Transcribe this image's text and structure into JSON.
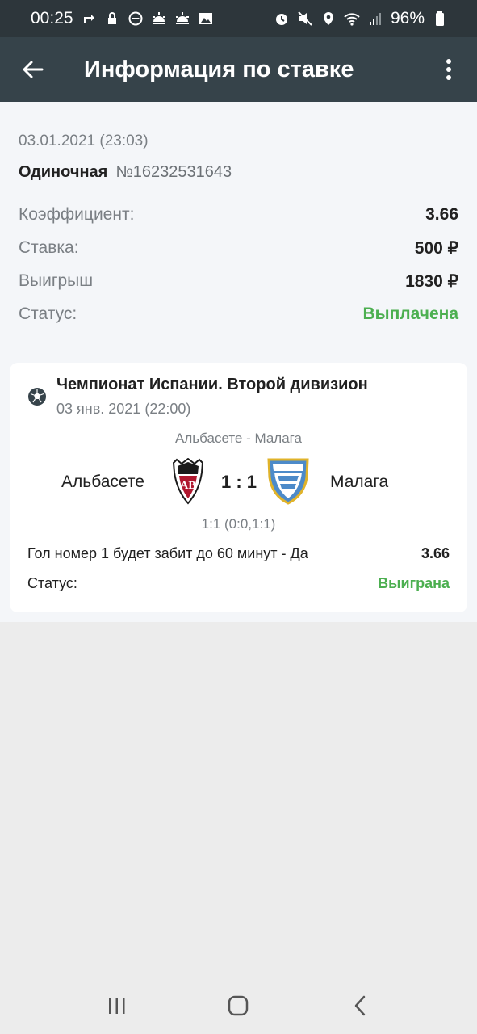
{
  "status_bar": {
    "time": "00:25",
    "battery": "96%"
  },
  "app_bar": {
    "title": "Информация по ставке"
  },
  "bet": {
    "date": "03.01.2021 (23:03)",
    "type": "Одиночная",
    "number": "№16232531643",
    "rows": [
      {
        "label": "Коэффициент:",
        "value": "3.66"
      },
      {
        "label": "Ставка:",
        "value": "500 ₽"
      },
      {
        "label": "Выигрыш",
        "value": "1830 ₽"
      },
      {
        "label": "Статус:",
        "value": "Выплачена"
      }
    ]
  },
  "event": {
    "league": "Чемпионат Испании. Второй дивизион",
    "date": "03 янв. 2021 (22:00)",
    "match": "Альбасете - Малага",
    "home_team": "Альбасете",
    "away_team": "Малага",
    "score": "1 : 1",
    "score_detail": "1:1 (0:0,1:1)",
    "outcome": "Гол номер 1 будет забит до 60 минут - Да",
    "outcome_odds": "3.66",
    "status_label": "Статус:",
    "status_value": "Выиграна"
  },
  "colors": {
    "status_bar": "#2d363b",
    "app_bar": "#36434a",
    "win_green": "#4caf50"
  }
}
